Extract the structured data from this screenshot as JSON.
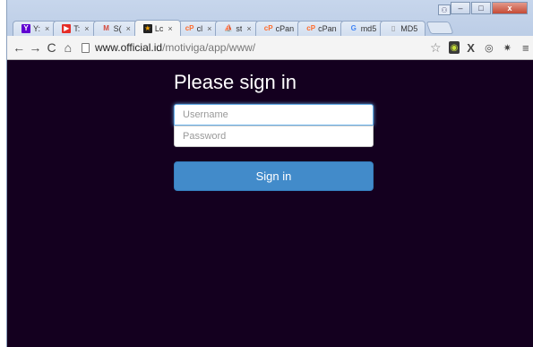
{
  "browser": {
    "tabs": [
      {
        "label": "Y:",
        "icon": "yahoo-icon",
        "icon_glyph": "Y",
        "color": "#5f01d1",
        "active": false
      },
      {
        "label": "T:",
        "icon": "youtube-icon",
        "icon_glyph": "▶",
        "color": "#e52d27",
        "active": false
      },
      {
        "label": "S(",
        "icon": "gmail-icon",
        "icon_glyph": "M",
        "color": "#d44638",
        "active": false
      },
      {
        "label": "Lc",
        "icon": "star-icon",
        "icon_glyph": "★",
        "color": "#f5a300",
        "active": true
      },
      {
        "label": "cl",
        "icon": "cpanel-icon",
        "icon_glyph": "cP",
        "color": "#ff6c2c",
        "active": false
      },
      {
        "label": "st",
        "icon": "pma-icon",
        "icon_glyph": "⛵",
        "color": "#6c78af",
        "active": false
      },
      {
        "label": "cPan",
        "icon": "cpanel-icon",
        "icon_glyph": "cP",
        "color": "#ff6c2c",
        "active": false
      },
      {
        "label": "cPan",
        "icon": "cpanel-icon",
        "icon_glyph": "cP",
        "color": "#ff6c2c",
        "active": false
      },
      {
        "label": "md5",
        "icon": "google-icon",
        "icon_glyph": "G",
        "color": "#4285f4",
        "active": false
      },
      {
        "label": "MD5",
        "icon": "page-icon",
        "icon_glyph": "▯",
        "color": "#888888",
        "active": false
      }
    ],
    "tab_close_glyph": "×",
    "window_controls": {
      "minimize": "–",
      "maximize": "□",
      "close": "x"
    },
    "url": {
      "domain": "www.official.id",
      "path": "/motiviga/app/www/"
    }
  },
  "page": {
    "title": "Please sign in",
    "username_placeholder": "Username",
    "password_placeholder": "Password",
    "signin_label": "Sign in"
  },
  "colors": {
    "background": "#14001f",
    "button": "#428bca",
    "focus": "#66afe9"
  }
}
